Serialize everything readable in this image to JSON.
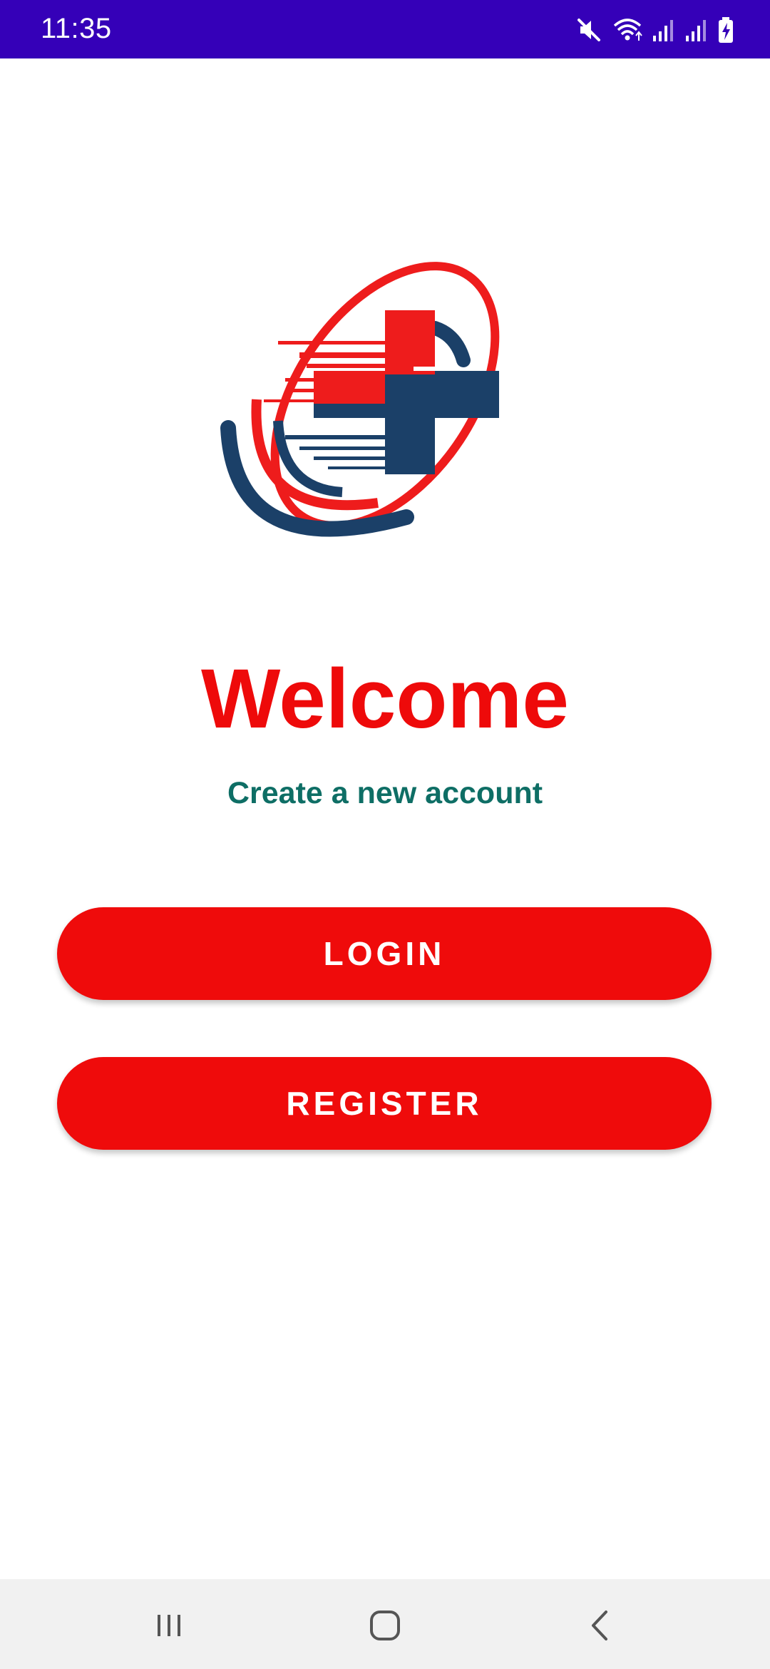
{
  "status_bar": {
    "time": "11:35",
    "icons": [
      "mute-icon",
      "wifi-icon",
      "signal-icon",
      "signal-icon",
      "battery-charging-icon"
    ],
    "background_color": "#3500b8"
  },
  "logo": {
    "icon": "medical-cross-logo",
    "colors": {
      "red": "#ee1c1c",
      "navy": "#1b4068"
    }
  },
  "main": {
    "title": "Welcome",
    "subtitle": "Create a new account",
    "title_color": "#ee0a0a",
    "subtitle_color": "#0e6e65"
  },
  "buttons": {
    "login_label": "LOGIN",
    "register_label": "REGISTER",
    "color": "#ef0b0b"
  },
  "nav_bar": {
    "items": [
      "recents-icon",
      "home-icon",
      "back-icon"
    ]
  }
}
